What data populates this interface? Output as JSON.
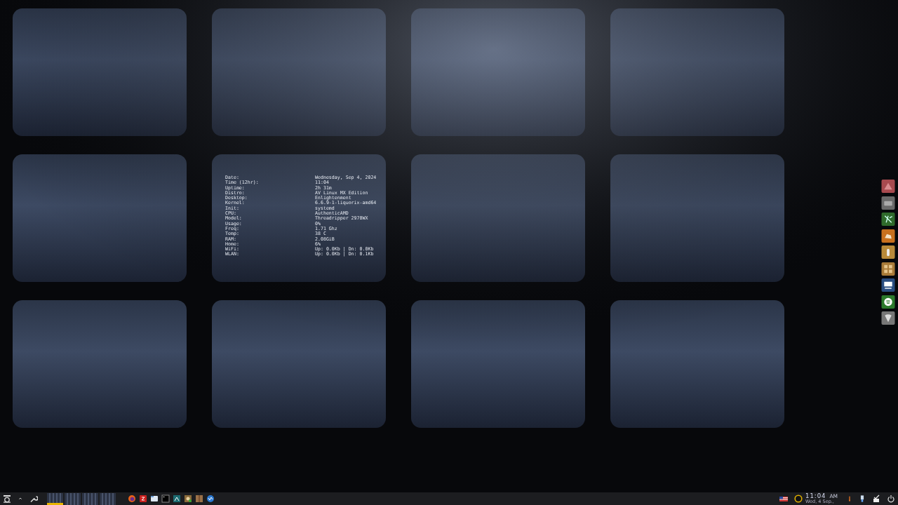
{
  "conky": {
    "rows": [
      {
        "label": "Date:",
        "value": "Wednesday, Sep 4, 2024"
      },
      {
        "label": "Time (12hr):",
        "value": "11:04"
      },
      {
        "label": "Uptime:",
        "value": "2h 31m"
      },
      {
        "label": "Distro:",
        "value": "AV Linux MX Edition"
      },
      {
        "label": "Desktop:",
        "value": "Enlightenment"
      },
      {
        "label": "Kernel:",
        "value": "6.6.9-1-liquorix-amd64"
      },
      {
        "label": "Init:",
        "value": "systemd"
      },
      {
        "label": "CPU:",
        "value": "AuthenticAMD"
      },
      {
        "label": "Model:",
        "value": "Threadripper 2970WX"
      },
      {
        "label": "Usage:",
        "value": "0%"
      },
      {
        "label": "Freq:",
        "value": "1.71 Ghz"
      },
      {
        "label": "Temp:",
        "value": "38 C"
      },
      {
        "label": "RAM:",
        "value": "2.08GiB"
      },
      {
        "label": "Home:",
        "value": "6%"
      },
      {
        "label": "WiFi:",
        "value": "Up: 0.0Kb | Dn: 0.0Kb"
      },
      {
        "label": "WLAN:",
        "value": "Up: 0.0Kb | Dn: 0.1Kb"
      }
    ]
  },
  "pager": {
    "desks": [
      {
        "selected": true
      },
      {
        "selected": false
      },
      {
        "selected": false
      },
      {
        "selected": false
      }
    ]
  },
  "clock": {
    "time": "11:04",
    "ampm": "AM",
    "date": "Wed, 4 Sep.,"
  }
}
